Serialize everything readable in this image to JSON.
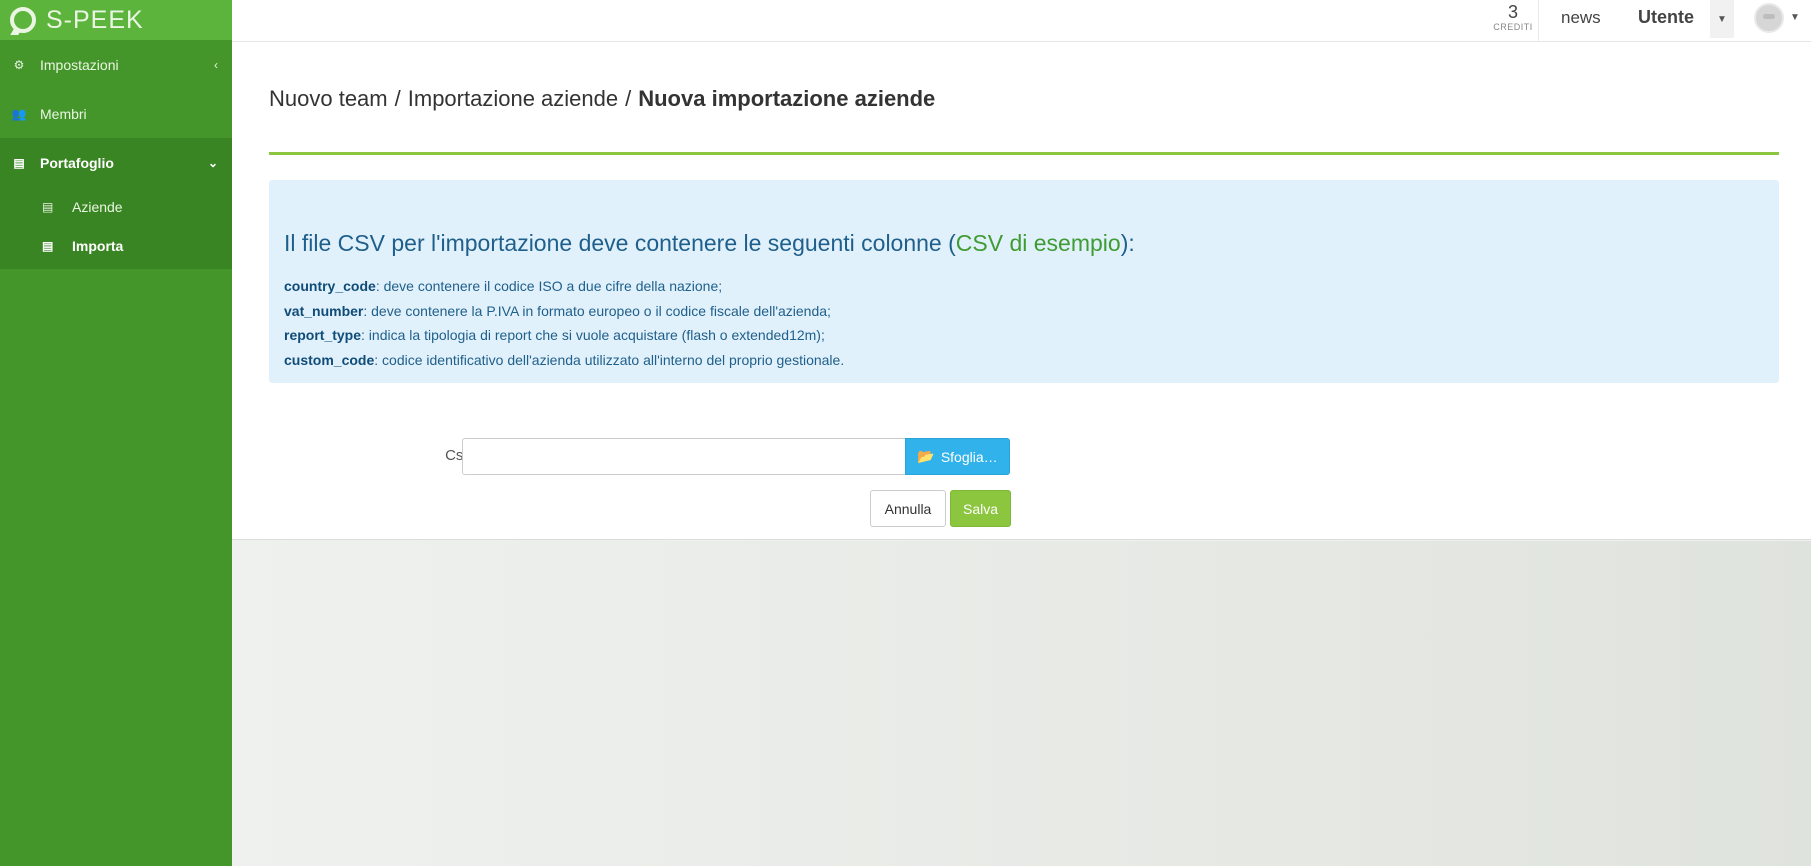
{
  "brand": {
    "name": "S-PEEK"
  },
  "sidebar": {
    "items": [
      {
        "label": "Impostazioni",
        "icon": "cogs-icon"
      },
      {
        "label": "Membri",
        "icon": "users-icon"
      },
      {
        "label": "Portafoglio",
        "icon": "book-icon"
      }
    ],
    "subitems": [
      {
        "label": "Aziende",
        "icon": "book-icon"
      },
      {
        "label": "Importa",
        "icon": "book-icon"
      }
    ]
  },
  "topbar": {
    "credits_value": "3",
    "credits_label": "CREDITI",
    "news_label": "news",
    "user_label": "Utente"
  },
  "breadcrumb": {
    "item1": "Nuovo team",
    "item2": "Importazione aziende",
    "current": "Nuova importazione aziende",
    "separator": "/"
  },
  "info": {
    "title_prefix": "Il file CSV per l'importazione deve contenere le seguenti colonne (",
    "title_link": "CSV di esempio",
    "title_suffix": "):",
    "columns": [
      {
        "name": "country_code",
        "desc": ": deve contenere il codice ISO a due cifre della nazione;"
      },
      {
        "name": "vat_number",
        "desc": ": deve contenere la P.IVA in formato europeo o il codice fiscale dell'azienda;"
      },
      {
        "name": "report_type",
        "desc": ": indica la tipologia di report che si vuole acquistare (flash o extended12m);"
      },
      {
        "name": "custom_code",
        "desc": ": codice identificativo dell'azienda utilizzato all'interno del proprio gestionale."
      }
    ]
  },
  "form": {
    "csv_label": "Csv",
    "csv_value": "",
    "browse_label": "Sfoglia…",
    "cancel_label": "Annulla",
    "save_label": "Salva"
  },
  "colors": {
    "sidebar": "#44962a",
    "brand_bar": "#5db43c",
    "accent_line": "#8cc63f",
    "info_bg": "#e1f1fb",
    "browse": "#32b2ea",
    "save": "#8cc63f"
  }
}
